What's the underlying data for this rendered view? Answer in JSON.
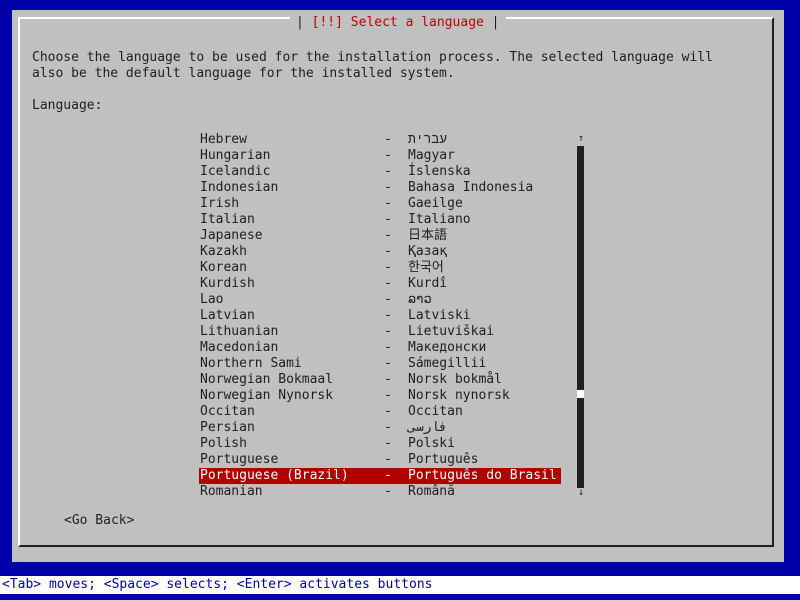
{
  "dialog": {
    "title": "[!!] Select a language",
    "description_line1": "Choose the language to be used for the installation process. The selected language will",
    "description_line2": "also be the default language for the installed system.",
    "list_label": "Language:"
  },
  "languages": [
    {
      "english": "Hebrew",
      "separator": "-",
      "native": "עברית",
      "selected": false
    },
    {
      "english": "Hungarian",
      "separator": "-",
      "native": "Magyar",
      "selected": false
    },
    {
      "english": "Icelandic",
      "separator": "-",
      "native": "Íslenska",
      "selected": false
    },
    {
      "english": "Indonesian",
      "separator": "-",
      "native": "Bahasa Indonesia",
      "selected": false
    },
    {
      "english": "Irish",
      "separator": "-",
      "native": "Gaeilge",
      "selected": false
    },
    {
      "english": "Italian",
      "separator": "-",
      "native": "Italiano",
      "selected": false
    },
    {
      "english": "Japanese",
      "separator": "-",
      "native": "日本語",
      "selected": false
    },
    {
      "english": "Kazakh",
      "separator": "-",
      "native": "Қазақ",
      "selected": false
    },
    {
      "english": "Korean",
      "separator": "-",
      "native": "한국어",
      "selected": false
    },
    {
      "english": "Kurdish",
      "separator": "-",
      "native": "Kurdî",
      "selected": false
    },
    {
      "english": "Lao",
      "separator": "-",
      "native": "ລາວ",
      "selected": false
    },
    {
      "english": "Latvian",
      "separator": "-",
      "native": "Latviski",
      "selected": false
    },
    {
      "english": "Lithuanian",
      "separator": "-",
      "native": "Lietuviškai",
      "selected": false
    },
    {
      "english": "Macedonian",
      "separator": "-",
      "native": "Македонски",
      "selected": false
    },
    {
      "english": "Northern Sami",
      "separator": "-",
      "native": "Sámegillii",
      "selected": false
    },
    {
      "english": "Norwegian Bokmaal",
      "separator": "-",
      "native": "Norsk bokmål",
      "selected": false
    },
    {
      "english": "Norwegian Nynorsk",
      "separator": "-",
      "native": "Norsk nynorsk",
      "selected": false
    },
    {
      "english": "Occitan",
      "separator": "-",
      "native": "Occitan",
      "selected": false
    },
    {
      "english": "Persian",
      "separator": "-",
      "native": "فارسی",
      "selected": false
    },
    {
      "english": "Polish",
      "separator": "-",
      "native": "Polski",
      "selected": false
    },
    {
      "english": "Portuguese",
      "separator": "-",
      "native": "Português",
      "selected": false
    },
    {
      "english": "Portuguese (Brazil)",
      "separator": "-",
      "native": "Português do Brasil",
      "selected": true
    },
    {
      "english": "Romanian",
      "separator": "-",
      "native": "Română",
      "selected": false
    }
  ],
  "scrollbar": {
    "up_arrow": "↑",
    "down_arrow": "↓",
    "position_fraction": 0.73
  },
  "buttons": {
    "go_back": "<Go Back>"
  },
  "footer": {
    "help_text": "<Tab> moves; <Space> selects; <Enter> activates buttons"
  },
  "colors": {
    "background": "#0000a8",
    "dialog": "#c0c0c0",
    "selection": "#b00000",
    "title": "#c00000"
  }
}
